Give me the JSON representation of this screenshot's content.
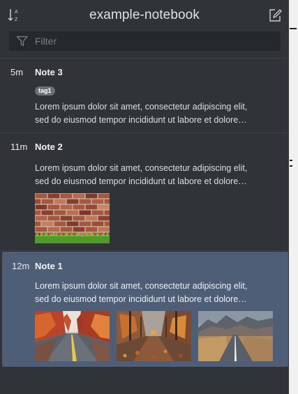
{
  "header": {
    "title": "example-notebook",
    "sort_icon": "sort-alpha-icon",
    "new_note_icon": "edit-icon"
  },
  "filter": {
    "placeholder": "Filter",
    "value": "",
    "icon": "funnel-icon"
  },
  "notes": [
    {
      "time": "5m",
      "title": "Note 3",
      "tags": [
        "tag1"
      ],
      "preview_line1": "Lorem ipsum dolor sit amet, consectetur adipiscing elit,",
      "preview_line2": "sed do eiusmod tempor incididunt ut labore et dolore…",
      "images": []
    },
    {
      "time": "11m",
      "title": "Note 2",
      "tags": [],
      "preview_line1": "Lorem ipsum dolor sit amet, consectetur adipiscing elit,",
      "preview_line2": "sed do eiusmod tempor incididunt ut labore et dolore…",
      "images": [
        "brick-wall-image"
      ]
    },
    {
      "time": "12m",
      "title": "Note 1",
      "tags": [],
      "selected": true,
      "preview_line1": "Lorem ipsum dolor sit amet, consectetur adipiscing elit,",
      "preview_line2": "sed do eiusmod tempor incididunt ut labore et dolore…",
      "images": [
        "autumn-road-image",
        "autumn-forest-path-image",
        "mountain-road-image"
      ]
    }
  ],
  "colors": {
    "panel_bg": "#303337",
    "selected_bg": "#4f5e77",
    "tag_bg": "#6c7177",
    "text": "#dcdfe2"
  }
}
